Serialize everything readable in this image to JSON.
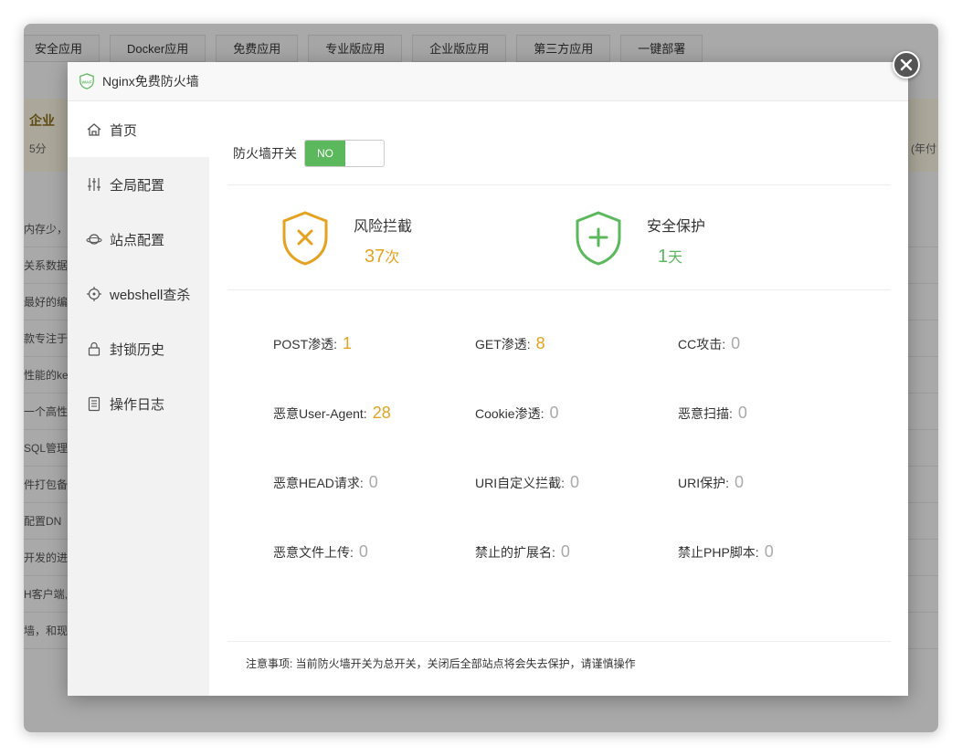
{
  "background": {
    "tabs": [
      "安全应用",
      "Docker应用",
      "免费应用",
      "专业版应用",
      "企业版应用",
      "第三方应用",
      "一键部署"
    ],
    "banner_line1": "企业",
    "banner_line2": "5分",
    "banner_right": "(年付",
    "rows": [
      "内存少，并",
      "关系数据库",
      "最好的编程",
      "款专注于",
      "性能的ke",
      "一个高性",
      "SQL管理工",
      "件打包备份",
      "配置DN",
      "开发的进",
      "H客户端,",
      "墙，和现"
    ]
  },
  "modal": {
    "title": "Nginx免费防火墙",
    "logo_text": "WAF"
  },
  "sidebar": {
    "items": [
      {
        "label": "首页",
        "icon": "home-icon"
      },
      {
        "label": "全局配置",
        "icon": "sliders-icon"
      },
      {
        "label": "站点配置",
        "icon": "planet-icon"
      },
      {
        "label": "webshell查杀",
        "icon": "target-icon"
      },
      {
        "label": "封锁历史",
        "icon": "lock-icon"
      },
      {
        "label": "操作日志",
        "icon": "log-icon"
      }
    ]
  },
  "firewall": {
    "switch_label": "防火墙开关",
    "switch_state": "NO"
  },
  "stats": {
    "risk": {
      "label": "风险拦截",
      "value": "37",
      "unit": "次",
      "color": "#e5a21f"
    },
    "safe": {
      "label": "安全保护",
      "value": "1",
      "unit": "天",
      "color": "#5cb85c"
    }
  },
  "metrics": [
    {
      "label": "POST渗透:",
      "value": "1"
    },
    {
      "label": "GET渗透:",
      "value": "8"
    },
    {
      "label": "CC攻击:",
      "value": "0"
    },
    {
      "label": "恶意User-Agent:",
      "value": "28"
    },
    {
      "label": "Cookie渗透:",
      "value": "0"
    },
    {
      "label": "恶意扫描:",
      "value": "0"
    },
    {
      "label": "恶意HEAD请求:",
      "value": "0"
    },
    {
      "label": "URI自定义拦截:",
      "value": "0"
    },
    {
      "label": "URI保护:",
      "value": "0"
    },
    {
      "label": "恶意文件上传:",
      "value": "0"
    },
    {
      "label": "禁止的扩展名:",
      "value": "0"
    },
    {
      "label": "禁止PHP脚本:",
      "value": "0"
    }
  ],
  "note": "注意事项: 当前防火墙开关为总开关，关闭后全部站点将会失去保护，请谨慎操作"
}
